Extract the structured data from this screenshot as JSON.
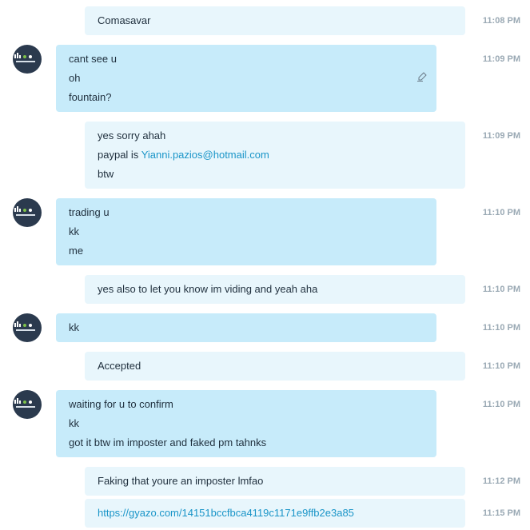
{
  "messages": [
    {
      "sender": "me",
      "lines": [
        "Comasavar"
      ],
      "time": "11:08 PM"
    },
    {
      "sender": "them",
      "lines": [
        "cant see u",
        "oh",
        "fountain?"
      ],
      "time": "11:09 PM",
      "edited": true
    },
    {
      "sender": "me",
      "lines": [
        "yes sorry ahah",
        "paypal is ",
        "btw"
      ],
      "email": "Yianni.pazios@hotmail.com",
      "time": "11:09 PM"
    },
    {
      "sender": "them",
      "lines": [
        "trading u",
        "kk",
        "me"
      ],
      "time": "11:10 PM"
    },
    {
      "sender": "me",
      "lines": [
        "yes also to let you know im viding and yeah aha"
      ],
      "time": "11:10 PM"
    },
    {
      "sender": "them",
      "lines": [
        "kk"
      ],
      "time": "11:10 PM"
    },
    {
      "sender": "me",
      "lines": [
        "Accepted"
      ],
      "time": "11:10 PM"
    },
    {
      "sender": "them",
      "lines": [
        "waiting for u to confirm",
        "kk",
        "got it btw im imposter and faked pm tahnks"
      ],
      "time": "11:10 PM"
    },
    {
      "sender": "me",
      "lines": [
        "Faking that youre an imposter lmfao"
      ],
      "time": "11:12 PM"
    },
    {
      "sender": "me",
      "link": "https://gyazo.com/14151bccfbca4119c1171e9ffb2e3a85",
      "time": "11:15 PM"
    }
  ],
  "icons": {
    "avatar": "user-avatar-icon",
    "edited": "pencil-icon"
  },
  "colors": {
    "my_bubble": "#e8f6fc",
    "their_bubble": "#c7ebfa",
    "link": "#1a95c8",
    "timestamp": "#9aa9b4"
  }
}
